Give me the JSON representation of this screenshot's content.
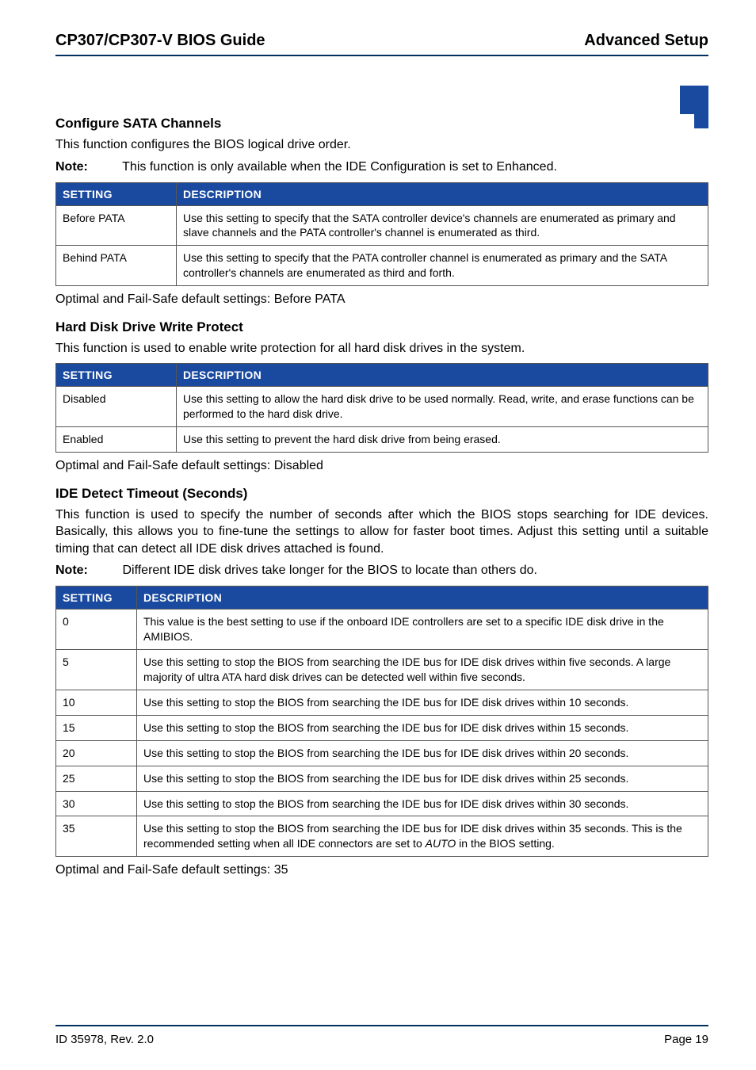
{
  "header": {
    "left": "CP307/CP307-V BIOS Guide",
    "right": "Advanced Setup"
  },
  "sec1": {
    "title": "Configure SATA Channels",
    "intro": "This function configures the BIOS logical drive order.",
    "note_label": "Note:",
    "note_text": "This function is only available when the IDE Configuration is set to Enhanced.",
    "th_setting": "SETTING",
    "th_desc": "DESCRIPTION",
    "r1_s": "Before PATA",
    "r1_d": "Use this setting to specify that the SATA controller device's channels are enumerated as primary and slave channels and the PATA controller's channel is enumerated as third.",
    "r2_s": "Behind PATA",
    "r2_d": "Use this setting to specify that the PATA controller channel is enumerated as primary and the SATA controller's channels are enumerated as third and forth.",
    "footer": "Optimal and Fail-Safe default settings: Before PATA"
  },
  "sec2": {
    "title": "Hard Disk Drive Write Protect",
    "intro": "This function is used to enable write protection for all hard disk drives in the system.",
    "th_setting": "SETTING",
    "th_desc": "DESCRIPTION",
    "r1_s": "Disabled",
    "r1_d": "Use this setting to allow the hard disk drive to be used normally. Read, write, and erase functions can be performed to the hard disk drive.",
    "r2_s": "Enabled",
    "r2_d": "Use this setting to prevent the hard disk drive from being erased.",
    "footer": "Optimal and Fail-Safe default settings: Disabled"
  },
  "sec3": {
    "title": "IDE Detect Timeout (Seconds)",
    "intro": "This function is used to specify the number of seconds after which the BIOS stops searching for IDE devices. Basically, this allows you to fine-tune the settings to allow for faster boot times. Adjust this setting until a suitable timing that can detect all IDE disk drives attached is found.",
    "note_label": "Note:",
    "note_text": "Different IDE disk drives take longer for the BIOS to locate than others do.",
    "th_setting": "SETTING",
    "th_desc": "DESCRIPTION",
    "r0_s": "0",
    "r0_d": "This value is the best setting to use if the onboard IDE controllers are set to a specific IDE disk drive in the AMIBIOS.",
    "r5_s": "5",
    "r5_d": "Use this setting to stop the BIOS from searching the IDE bus for IDE disk drives within five seconds. A large majority of ultra ATA hard disk drives can be detected well within five seconds.",
    "r10_s": "10",
    "r10_d": "Use this setting to stop the BIOS from searching the IDE bus for IDE disk drives within 10 seconds.",
    "r15_s": "15",
    "r15_d": "Use this setting to stop the BIOS from searching the IDE bus for IDE disk drives within 15 seconds.",
    "r20_s": "20",
    "r20_d": "Use this setting to stop the BIOS from searching the IDE bus for IDE disk drives within 20 seconds.",
    "r25_s": "25",
    "r25_d": "Use this setting to stop the BIOS from searching the IDE bus for IDE disk drives within 25 seconds.",
    "r30_s": "30",
    "r30_d": "Use this setting to stop the BIOS from searching the IDE bus for IDE disk drives within 30 seconds.",
    "r35_s": "35",
    "r35_d_pre": "Use this setting to stop the BIOS from searching the IDE bus for IDE disk drives within 35 seconds. This is the recommended setting when all IDE connectors are set to ",
    "r35_d_italic": "AUTO",
    "r35_d_post": " in the BIOS setting.",
    "footer": "Optimal and Fail-Safe default settings: 35"
  },
  "footer": {
    "left": "ID 35978, Rev. 2.0",
    "right": "Page 19"
  }
}
